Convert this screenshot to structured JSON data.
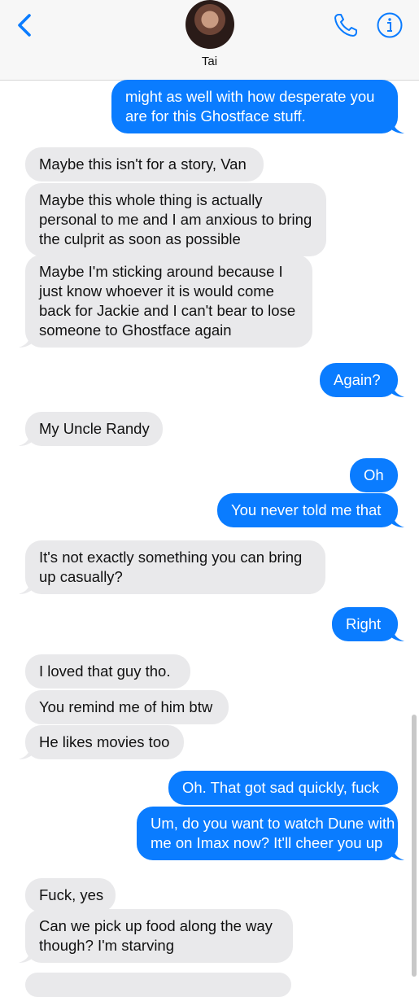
{
  "header": {
    "contact_name": "Tai"
  },
  "messages": [
    {
      "dir": "out",
      "lines": [
        "might as well with how desperate you",
        "are for this Ghostface stuff."
      ]
    },
    {
      "dir": "in",
      "lines": [
        "Maybe this isn't for a story, Van"
      ]
    },
    {
      "dir": "in",
      "lines": [
        "Maybe this whole thing is actually",
        "personal to me and I am anxious to bring",
        "the culprit as soon as possible"
      ]
    },
    {
      "dir": "in",
      "lines": [
        "Maybe I'm sticking around because I",
        "just know whoever it is would come",
        "back for Jackie and I can't bear to lose",
        "someone to Ghostface again"
      ]
    },
    {
      "dir": "out",
      "lines": [
        "Again?"
      ]
    },
    {
      "dir": "in",
      "lines": [
        "My Uncle Randy"
      ]
    },
    {
      "dir": "out",
      "lines": [
        "Oh"
      ]
    },
    {
      "dir": "out",
      "lines": [
        "You never told me that"
      ]
    },
    {
      "dir": "in",
      "lines": [
        "It's not exactly something you can bring",
        "up casually?"
      ]
    },
    {
      "dir": "out",
      "lines": [
        "Right"
      ]
    },
    {
      "dir": "in",
      "lines": [
        "I loved that guy tho."
      ]
    },
    {
      "dir": "in",
      "lines": [
        "You remind me of him btw"
      ]
    },
    {
      "dir": "in",
      "lines": [
        "He likes movies too"
      ]
    },
    {
      "dir": "out",
      "lines": [
        "Oh. That got sad quickly, fuck"
      ]
    },
    {
      "dir": "out",
      "lines": [
        "Um, do you want to watch Dune with",
        "me on Imax now? It'll cheer you up"
      ]
    },
    {
      "dir": "in",
      "lines": [
        "Fuck, yes"
      ]
    },
    {
      "dir": "in",
      "lines": [
        "Can we pick up food along the way",
        "though? I'm starving"
      ]
    }
  ],
  "colors": {
    "outgoing_bubble": "#0a7cff",
    "incoming_bubble": "#e9e9eb",
    "accent": "#0a7cff"
  },
  "icons": {
    "back": "chevron-left-icon",
    "call": "phone-icon",
    "info": "info-icon"
  }
}
